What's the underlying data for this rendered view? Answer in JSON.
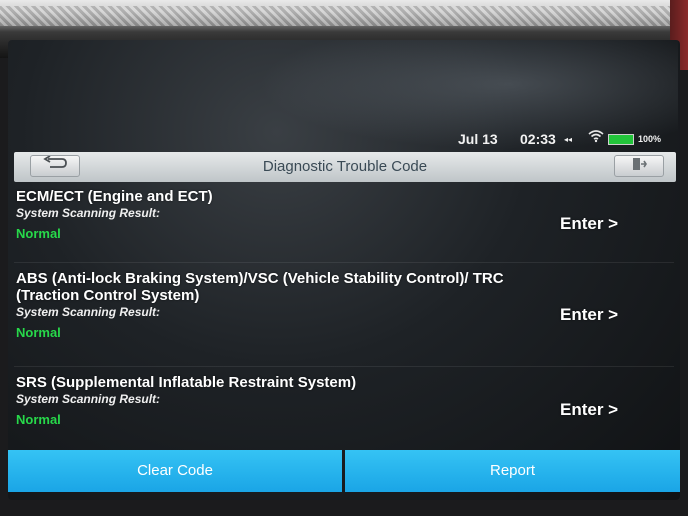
{
  "status_bar": {
    "date": "Jul 13",
    "time": "02:33",
    "battery_pct": "100%",
    "battery_level": 1.0
  },
  "header": {
    "title": "Diagnostic Trouble Code",
    "back_icon": "back-arrow-icon",
    "exit_icon": "exit-door-icon"
  },
  "systems": [
    {
      "name": "ECM/ECT (Engine and ECT)",
      "result_label": "System Scanning Result:",
      "result": "Normal",
      "action": "Enter >"
    },
    {
      "name": "ABS (Anti-lock Braking System)/VSC (Vehicle Stability Control)/ TRC (Traction Control System)",
      "result_label": "System Scanning Result:",
      "result": "Normal",
      "action": "Enter >"
    },
    {
      "name": "SRS (Supplemental Inflatable Restraint System)",
      "result_label": "System Scanning Result:",
      "result": "Normal",
      "action": "Enter >"
    }
  ],
  "footer": {
    "clear_label": "Clear Code",
    "report_label": "Report"
  },
  "colors": {
    "accent": "#1fb0ec",
    "normal": "#27d84a"
  }
}
